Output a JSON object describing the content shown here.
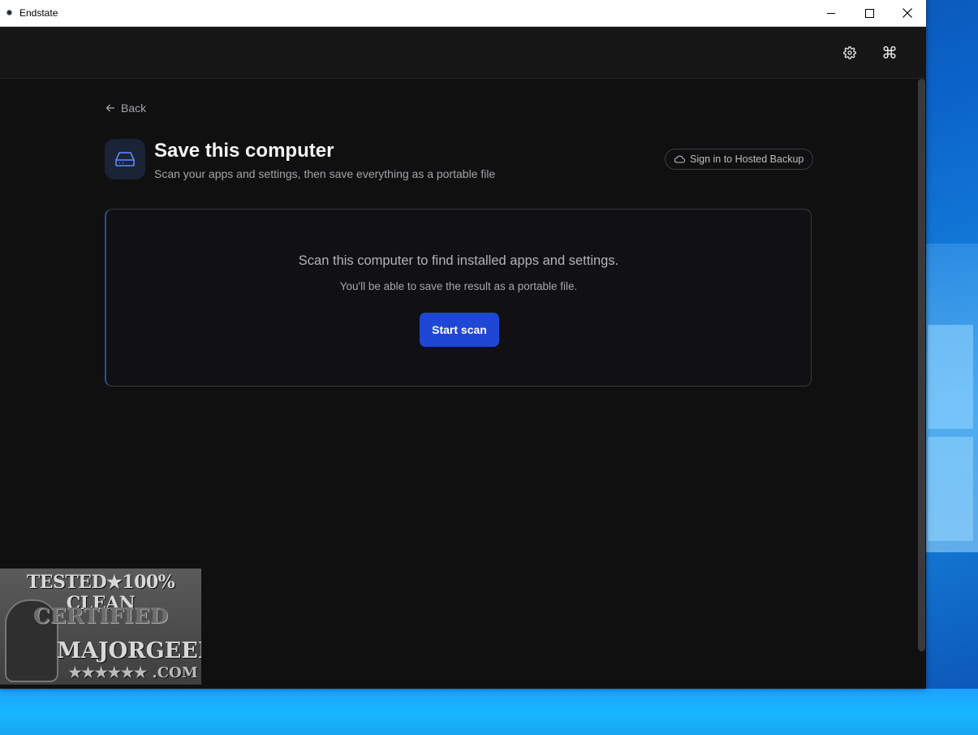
{
  "window": {
    "title": "Endstate"
  },
  "titlebar_controls": {
    "minimize": "minimize-icon",
    "maximize": "maximize-icon",
    "close": "close-icon"
  },
  "appbar": {
    "settings_icon": "gear-icon",
    "command_icon": "command-icon",
    "command_glyph": "⌘"
  },
  "nav": {
    "back_label": "Back"
  },
  "header": {
    "icon": "drive-icon",
    "title": "Save this computer",
    "subtitle": "Scan your apps and settings, then save everything as a portable file"
  },
  "signin": {
    "label": "Sign in to Hosted Backup",
    "icon": "cloud-icon"
  },
  "scan": {
    "message": "Scan this computer to find installed apps and settings.",
    "hint": "You'll be able to save the result as a portable file.",
    "button_label": "Start scan"
  },
  "watermark": {
    "line1": "TESTED★100% CLEAN",
    "line2": "CERTIFIED",
    "line3": "MAJORGEEKS",
    "line4": "★★★★★★ .COM"
  },
  "colors": {
    "background": "#101011",
    "accent": "#1e47d6",
    "card_border": "#3a3a3e"
  }
}
